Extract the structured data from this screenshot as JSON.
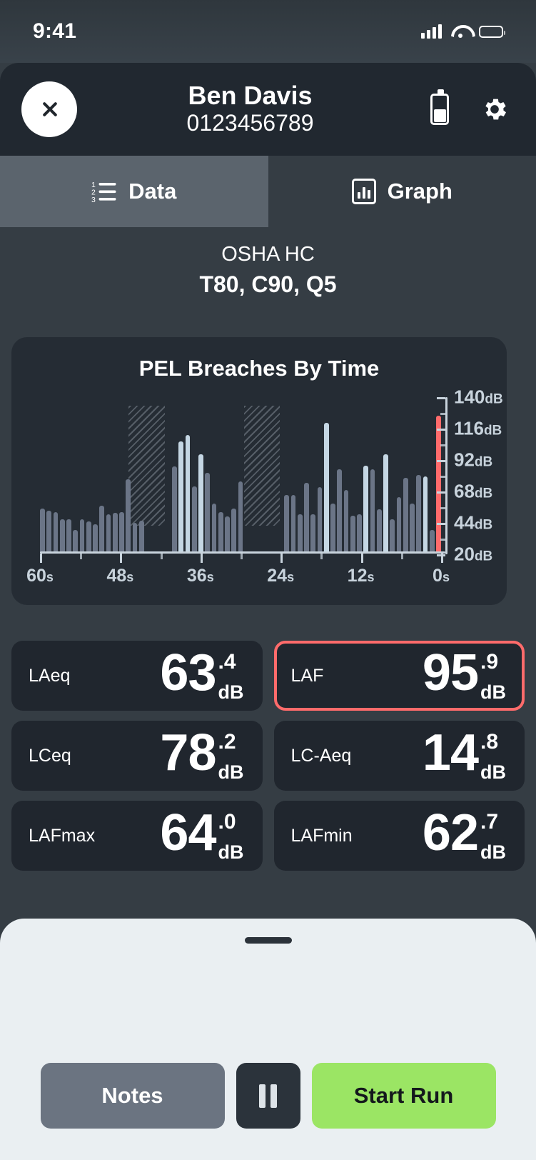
{
  "status_bar": {
    "time": "9:41",
    "signal_icon": "cellular-bars-icon",
    "wifi_icon": "wifi-icon",
    "battery_icon": "battery-icon"
  },
  "header": {
    "close_label": "",
    "name": "Ben Davis",
    "device_id": "0123456789",
    "battery_icon": "battery-icon",
    "settings_icon": "gear-icon"
  },
  "tabs": [
    {
      "label": "Data",
      "icon": "ordered-list-icon",
      "active": true
    },
    {
      "label": "Graph",
      "icon": "bar-chart-icon",
      "active": false
    }
  ],
  "mode": {
    "standard": "OSHA HC",
    "params": "T80, C90, Q5"
  },
  "colors": {
    "accent_red": "#ff6b6b",
    "bar_dark": "#6b7587",
    "bar_light": "#c5d7e4",
    "start_green": "#9be564",
    "card_bg": "#20262e",
    "chart_bg": "#252c34",
    "page_bg": "#353d44"
  },
  "chart_data": {
    "type": "bar",
    "title": "PEL Breaches By Time",
    "xlabel": "",
    "ylabel": "",
    "ylim": [
      20,
      140
    ],
    "grid": false,
    "legend": null,
    "y_ticks": [
      "140dB",
      "116dB",
      "92dB",
      "68dB",
      "44dB",
      "20dB"
    ],
    "y_tick_values": [
      140,
      116,
      92,
      68,
      44,
      20
    ],
    "x_ticks": [
      "60s",
      "48s",
      "36s",
      "24s",
      "12s",
      "0s"
    ],
    "x_tick_values": [
      60,
      48,
      36,
      24,
      12,
      0
    ],
    "unit": "dB",
    "shaded_regions": [
      {
        "start_s": 46.5,
        "end_s": 41.0,
        "label": "breach-band"
      },
      {
        "start_s": 29.0,
        "end_s": 23.5,
        "label": "breach-band"
      }
    ],
    "categories": [
      "60s",
      "59s",
      "58s",
      "57s",
      "56s",
      "55s",
      "54s",
      "53s",
      "52s",
      "51s",
      "50s",
      "49s",
      "48s",
      "47s",
      "46s",
      "45s",
      "44s",
      "43s",
      "42s",
      "41s",
      "40s",
      "39s",
      "38s",
      "37s",
      "36s",
      "35s",
      "34s",
      "33s",
      "32s",
      "31s",
      "30s",
      "29s",
      "28s",
      "27s",
      "26s",
      "25s",
      "24s",
      "23s",
      "22s",
      "21s",
      "20s",
      "19s",
      "18s",
      "17s",
      "16s",
      "15s",
      "14s",
      "13s",
      "12s",
      "11s",
      "10s",
      "9s",
      "8s",
      "7s",
      "6s",
      "5s",
      "4s",
      "3s",
      "2s",
      "1s",
      "0s"
    ],
    "values": [
      56,
      54,
      53,
      47,
      47,
      38,
      47,
      45,
      43,
      58,
      51,
      52,
      53,
      80,
      44,
      46,
      20,
      20,
      20,
      20,
      90,
      111,
      116,
      74,
      100,
      85,
      60,
      53,
      49,
      56,
      78,
      20,
      20,
      20,
      20,
      20,
      20,
      67,
      67,
      51,
      77,
      51,
      73,
      126,
      60,
      88,
      71,
      50,
      51,
      91,
      88,
      55,
      100,
      47,
      65,
      81,
      60,
      83,
      82,
      38,
      132
    ],
    "series_styles": [
      {
        "name": "normal",
        "color": "#6b7587"
      },
      {
        "name": "elevated",
        "color": "#c5d7e4"
      },
      {
        "name": "current",
        "color": "#ff6b6b"
      }
    ],
    "bar_types": [
      "normal",
      "normal",
      "normal",
      "normal",
      "normal",
      "normal",
      "normal",
      "normal",
      "normal",
      "normal",
      "normal",
      "normal",
      "normal",
      "normal",
      "normal",
      "normal",
      "hatch",
      "hatch",
      "hatch",
      "hatch",
      "normal",
      "light",
      "light",
      "normal",
      "light",
      "normal",
      "normal",
      "normal",
      "normal",
      "normal",
      "normal",
      "hatch",
      "hatch",
      "hatch",
      "hatch",
      "hatch",
      "hatch",
      "normal",
      "normal",
      "normal",
      "normal",
      "normal",
      "normal",
      "light",
      "normal",
      "normal",
      "normal",
      "normal",
      "normal",
      "light",
      "normal",
      "normal",
      "light",
      "normal",
      "normal",
      "normal",
      "normal",
      "normal",
      "light",
      "normal",
      "current"
    ]
  },
  "metrics": [
    {
      "label": "LAeq",
      "int": "63",
      "dec": ".4",
      "unit": "dB",
      "alert": false
    },
    {
      "label": "LAF",
      "int": "95",
      "dec": ".9",
      "unit": "dB",
      "alert": true
    },
    {
      "label": "LCeq",
      "int": "78",
      "dec": ".2",
      "unit": "dB",
      "alert": false
    },
    {
      "label": "LC-Aeq",
      "int": "14",
      "dec": ".8",
      "unit": "dB",
      "alert": false
    },
    {
      "label": "LAFmax",
      "int": "64",
      "dec": ".0",
      "unit": "dB",
      "alert": false
    },
    {
      "label": "LAFmin",
      "int": "62",
      "dec": ".7",
      "unit": "dB",
      "alert": false
    }
  ],
  "sheet": {
    "grabber": "drag-handle",
    "notes_label": "Notes",
    "pause_icon": "pause-icon",
    "start_label": "Start Run"
  }
}
